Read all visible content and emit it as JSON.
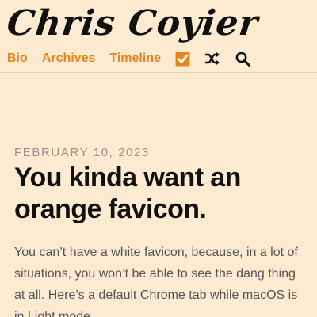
{
  "header": {
    "site_title": "Chris Coyier",
    "nav": [
      {
        "label": "Bio"
      },
      {
        "label": "Archives"
      },
      {
        "label": "Timeline"
      }
    ],
    "icons": [
      "checkbox-icon",
      "shuffle-icon",
      "search-icon"
    ]
  },
  "post": {
    "date": "FEBRUARY 10, 2023",
    "title": "You kinda want an orange favicon.",
    "body": "You can’t have a white favicon, because, in a lot of situations, you won’t be able to see the dang thing at all. Here’s a default Chrome tab while macOS is in Light mode."
  },
  "colors": {
    "background": "#fdebd1",
    "accent": "#e8861e",
    "text": "#111111",
    "muted": "#9a8f85"
  }
}
